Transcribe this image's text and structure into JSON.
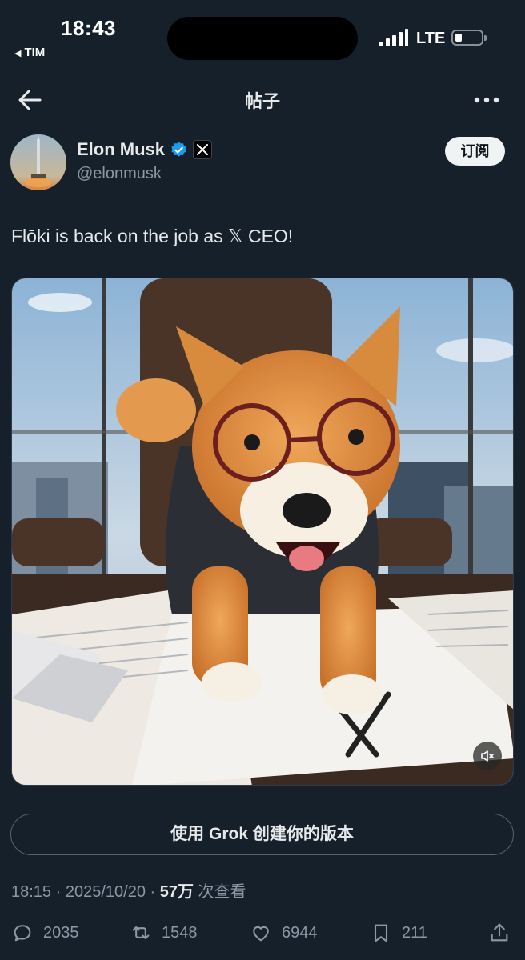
{
  "status_bar": {
    "time": "18:43",
    "back_app": "TIM",
    "network": "LTE",
    "back_app_icon": "triangle-left-icon"
  },
  "header": {
    "title": "帖子",
    "back_icon": "arrow-left-icon",
    "more_icon": "more-horizontal-icon"
  },
  "author": {
    "display_name": "Elon Musk",
    "handle": "@elonmusk",
    "verified_color": "#1d9bf0",
    "affiliate_badge": "x-logo-icon",
    "subscribe_label": "订阅"
  },
  "post": {
    "text_before": "Flōki is back on the job as ",
    "text_x": "𝕏",
    "text_after": " CEO!",
    "media_type": "video",
    "media_muted": true
  },
  "grok_button": {
    "label": "使用 Grok 创建你的版本"
  },
  "meta": {
    "time": "18:15",
    "date": "2025/10/20",
    "views_count": "57万",
    "views_label": " 次查看"
  },
  "actions": {
    "replies": "2035",
    "reposts": "1548",
    "likes": "6944",
    "bookmarks": "211"
  },
  "colors": {
    "background": "#15202b",
    "text": "#e7e9ea",
    "secondary": "#8b98a5",
    "accent": "#1d9bf0"
  }
}
